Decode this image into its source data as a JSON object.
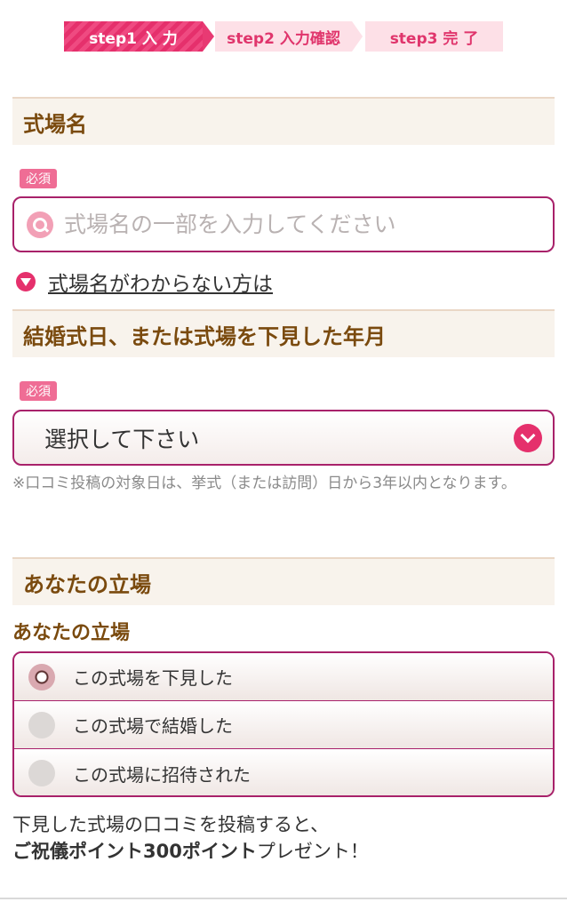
{
  "steps": [
    {
      "label": "step1 入 力",
      "active": true
    },
    {
      "label": "step2 入力確認",
      "active": false
    },
    {
      "label": "step3 完 了",
      "active": false
    }
  ],
  "venue": {
    "header": "式場名",
    "required_badge": "必須",
    "search_placeholder": "式場名の一部を入力してください",
    "help_link": "式場名がわからない方は"
  },
  "date": {
    "header": "結婚式日、または式場を下見した年月",
    "required_badge": "必須",
    "select_value": "選択して下さい",
    "note": "※口コミ投稿の対象日は、挙式（または訪問）日から3年以内となります。"
  },
  "position": {
    "header": "あなたの立場",
    "sub_label": "あなたの立場",
    "options": [
      {
        "label": "この式場を下見した",
        "checked": true
      },
      {
        "label": "この式場で結婚した",
        "checked": false
      },
      {
        "label": "この式場に招待された",
        "checked": false
      }
    ]
  },
  "promo": {
    "line1": "下見した式場の口コミを投稿すると、",
    "bold": "ご祝儀ポイント300ポイント",
    "tail": "プレゼント！"
  },
  "colors": {
    "accent": "#e5306c",
    "border": "#a8216a",
    "header_bg": "#f8f3ec",
    "header_text": "#7a4a0e"
  }
}
